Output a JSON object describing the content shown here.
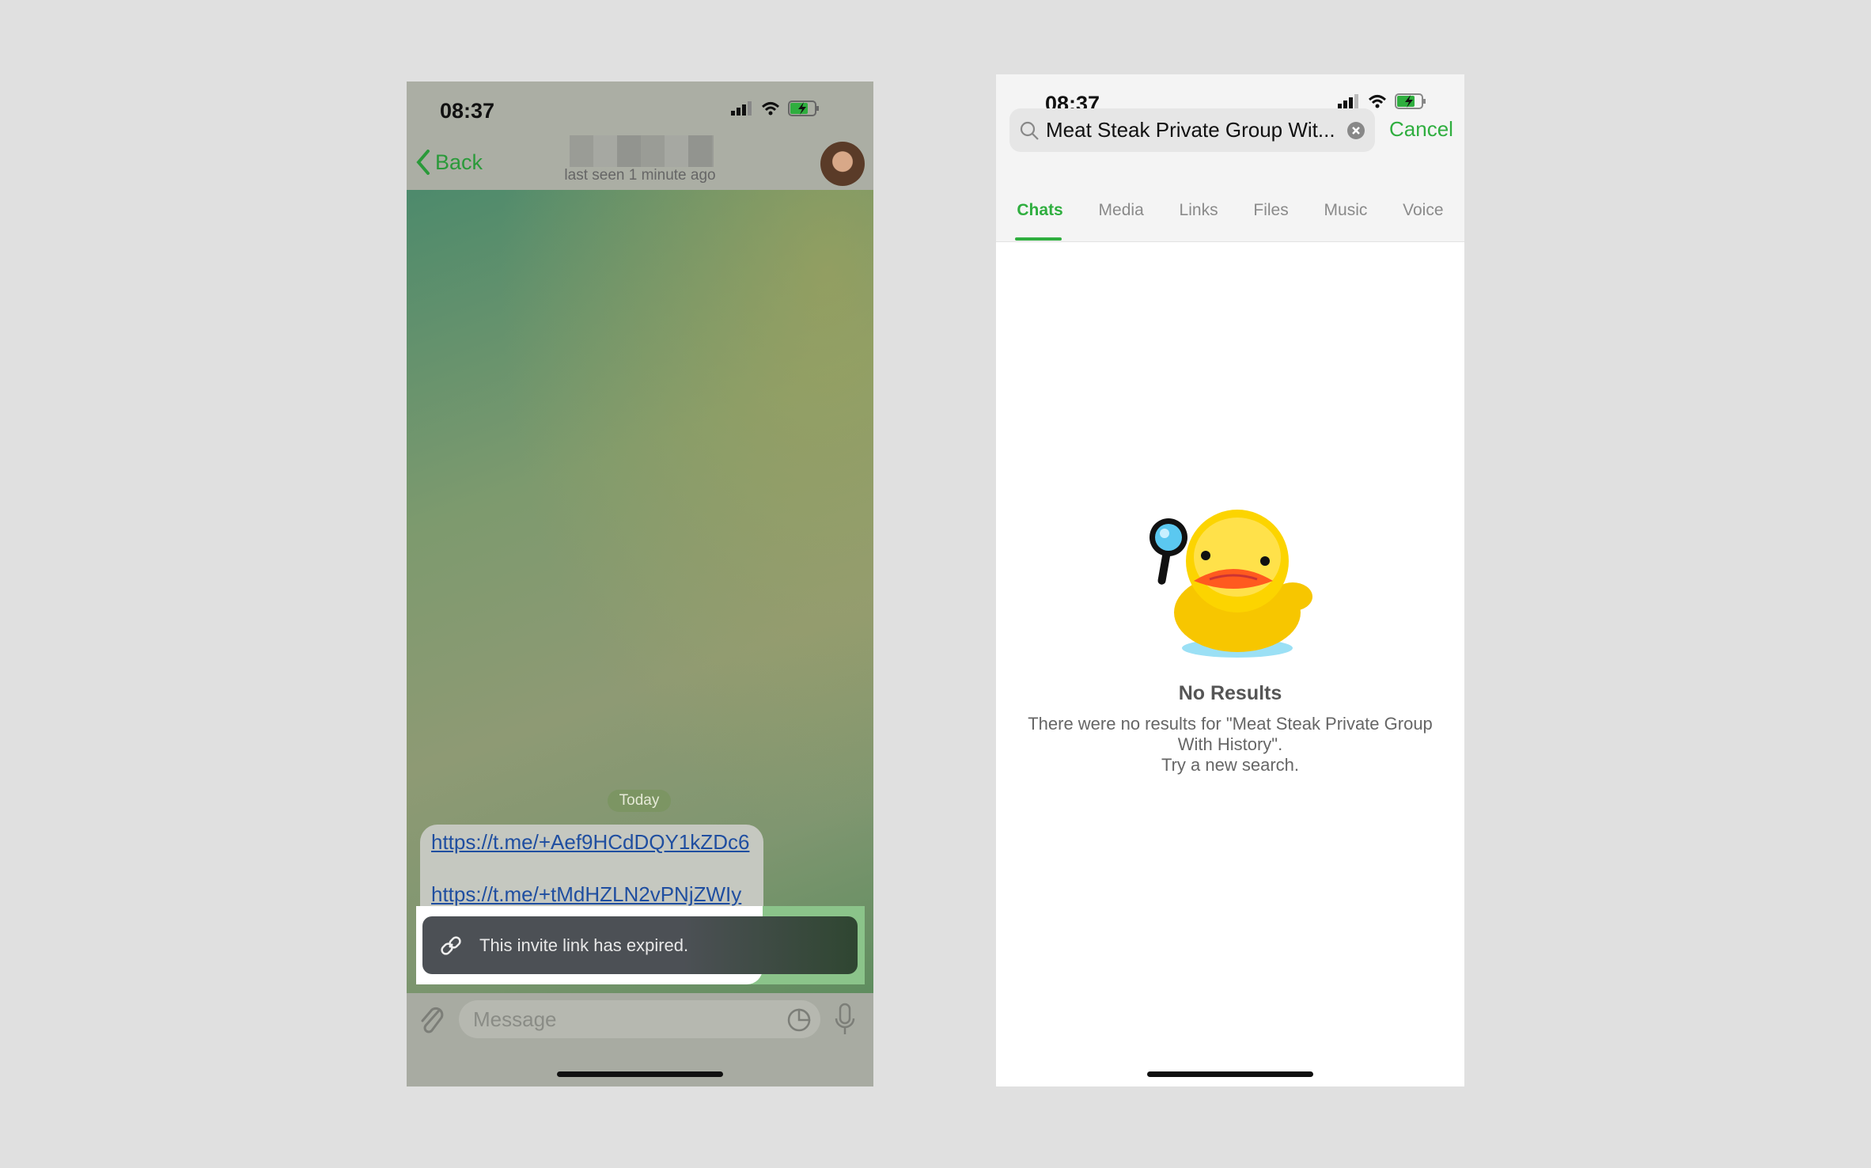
{
  "left_phone": {
    "status": {
      "time": "08:37"
    },
    "header": {
      "back_label": "Back",
      "subtitle": "last seen 1 minute ago"
    },
    "chat": {
      "date_pill": "Today",
      "links": [
        "https://t.me/+Aef9HCdDQY1kZDc6",
        "https://t.me/+tMdHZLN2vPNjZWIy"
      ]
    },
    "toast": {
      "text": "This invite link has expired."
    },
    "composer": {
      "placeholder": "Message"
    }
  },
  "right_phone": {
    "status": {
      "time": "08:37"
    },
    "search": {
      "value": "Meat Steak Private Group Wit...",
      "cancel_label": "Cancel"
    },
    "tabs": [
      {
        "label": "Chats",
        "active": true
      },
      {
        "label": "Media"
      },
      {
        "label": "Links"
      },
      {
        "label": "Files"
      },
      {
        "label": "Music"
      },
      {
        "label": "Voice"
      }
    ],
    "empty_state": {
      "title": "No Results",
      "lines": [
        "There were no results for \"Meat Steak Private Group",
        "With History\".",
        "Try a new search."
      ]
    }
  },
  "colors": {
    "accent": "#2fae3f",
    "link": "#1f4ea0"
  }
}
